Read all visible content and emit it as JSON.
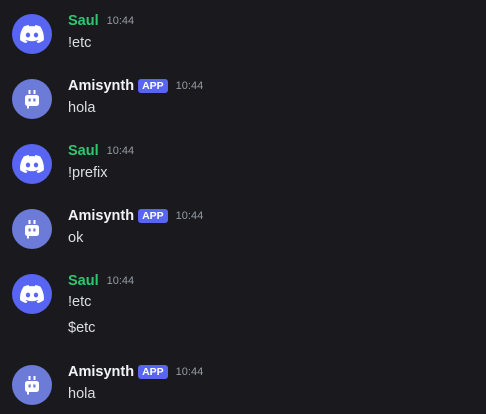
{
  "messages": [
    {
      "author": "Saul",
      "time": "10:44",
      "lines": [
        "!etc"
      ]
    },
    {
      "author": "Amisynth",
      "badge": "APP",
      "time": "10:44",
      "lines": [
        "hola"
      ]
    },
    {
      "author": "Saul",
      "time": "10:44",
      "lines": [
        "!prefix"
      ]
    },
    {
      "author": "Amisynth",
      "badge": "APP",
      "time": "10:44",
      "lines": [
        "ok"
      ]
    },
    {
      "author": "Saul",
      "time": "10:44",
      "lines": [
        "!etc",
        "$etc"
      ]
    },
    {
      "author": "Amisynth",
      "badge": "APP",
      "time": "10:44",
      "lines": [
        "hola"
      ]
    }
  ],
  "icons": {
    "user_avatar": "discord-logo-icon",
    "bot_avatar": "robot-icon"
  },
  "colors": {
    "background": "#1a1a1e",
    "user_name": "#2dc770",
    "bot_name": "#f2f3f5",
    "badge": "#5865f2",
    "avatar": "#5865f2",
    "timestamp": "#949ba4",
    "text": "#dbdee1"
  }
}
